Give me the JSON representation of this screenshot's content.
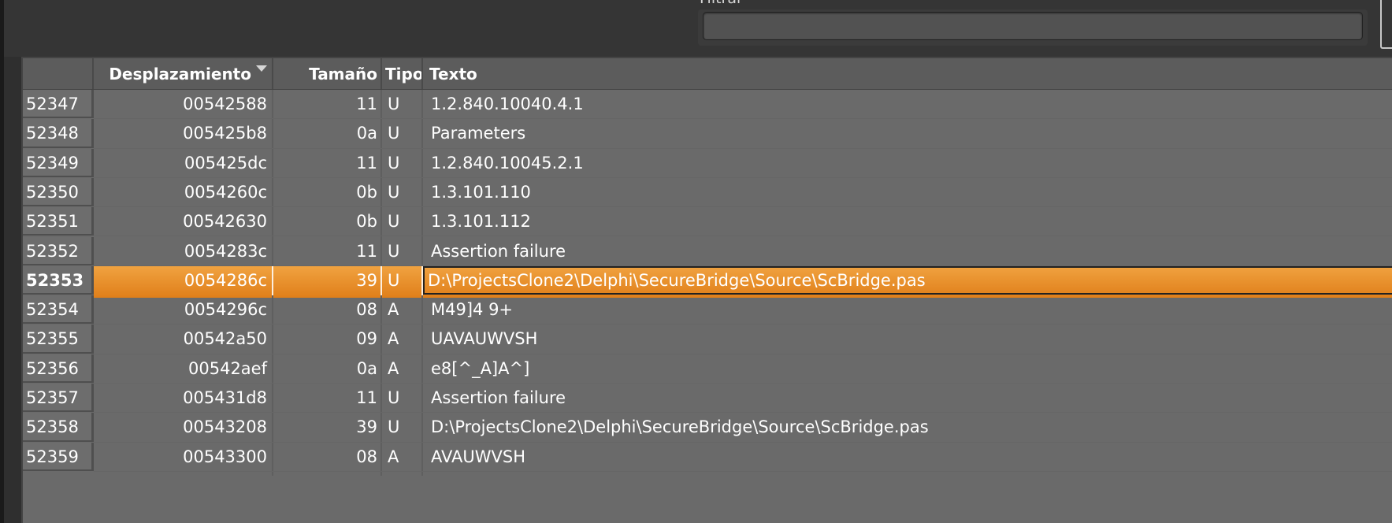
{
  "filter": {
    "label": "Filtrar",
    "value": "",
    "placeholder": ""
  },
  "table": {
    "columns": {
      "offset": "Desplazamiento",
      "size": "Tamaño",
      "type": "Tipo",
      "text": "Texto"
    },
    "sort_icon": "sort-descending-icon",
    "selected_row": "52353",
    "rows": [
      {
        "index": "52347",
        "offset": "00542588",
        "size": "11",
        "type": "U",
        "text": "1.2.840.10040.4.1"
      },
      {
        "index": "52348",
        "offset": "005425b8",
        "size": "0a",
        "type": "U",
        "text": "Parameters"
      },
      {
        "index": "52349",
        "offset": "005425dc",
        "size": "11",
        "type": "U",
        "text": "1.2.840.10045.2.1"
      },
      {
        "index": "52350",
        "offset": "0054260c",
        "size": "0b",
        "type": "U",
        "text": "1.3.101.110"
      },
      {
        "index": "52351",
        "offset": "00542630",
        "size": "0b",
        "type": "U",
        "text": "1.3.101.112"
      },
      {
        "index": "52352",
        "offset": "0054283c",
        "size": "11",
        "type": "U",
        "text": "Assertion failure"
      },
      {
        "index": "52353",
        "offset": "0054286c",
        "size": "39",
        "type": "U",
        "text": "D:\\ProjectsClone2\\Delphi\\SecureBridge\\Source\\ScBridge.pas"
      },
      {
        "index": "52354",
        "offset": "0054296c",
        "size": "08",
        "type": "A",
        "text": "M49]4  9+"
      },
      {
        "index": "52355",
        "offset": "00542a50",
        "size": "09",
        "type": "A",
        "text": "UAVAUWVSH"
      },
      {
        "index": "52356",
        "offset": "00542aef",
        "size": "0a",
        "type": "A",
        "text": "e8[^_A]A^]"
      },
      {
        "index": "52357",
        "offset": "005431d8",
        "size": "11",
        "type": "U",
        "text": "Assertion failure"
      },
      {
        "index": "52358",
        "offset": "00543208",
        "size": "39",
        "type": "U",
        "text": "D:\\ProjectsClone2\\Delphi\\SecureBridge\\Source\\ScBridge.pas"
      },
      {
        "index": "52359",
        "offset": "00543300",
        "size": "08",
        "type": "A",
        "text": "AVAUWVSH"
      }
    ]
  },
  "colors": {
    "selection": "#e88a25",
    "background": "#6a6a6a",
    "header": "#5c5c5c"
  }
}
